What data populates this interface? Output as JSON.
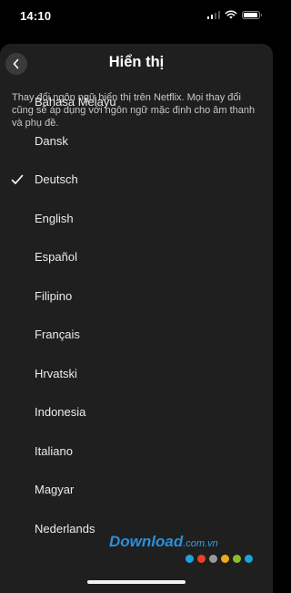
{
  "status_bar": {
    "time": "14:10"
  },
  "header": {
    "title": "Hiển thị",
    "back_icon": "chevron-left-icon"
  },
  "description": "Thay đổi ngôn ngữ hiển thị trên Netflix. Mọi thay đổi cũng sẽ áp dụng với ngôn ngữ mặc định cho âm thanh và phụ đề.",
  "languages": [
    {
      "label": "Bahasa Melayu",
      "selected": false
    },
    {
      "label": "Dansk",
      "selected": false
    },
    {
      "label": "Deutsch",
      "selected": true
    },
    {
      "label": "English",
      "selected": false
    },
    {
      "label": "Español",
      "selected": false
    },
    {
      "label": "Filipino",
      "selected": false
    },
    {
      "label": "Français",
      "selected": false
    },
    {
      "label": "Hrvatski",
      "selected": false
    },
    {
      "label": "Indonesia",
      "selected": false
    },
    {
      "label": "Italiano",
      "selected": false
    },
    {
      "label": "Magyar",
      "selected": false
    },
    {
      "label": "Nederlands",
      "selected": false
    }
  ],
  "watermark": {
    "main": "Download",
    "suffix": ".com.vn",
    "dot_colors": [
      "#1aa3dc",
      "#e8412c",
      "#9a9a9a",
      "#f0a818",
      "#8cbf26",
      "#1aa3dc"
    ]
  },
  "colors": {
    "background": "#000000",
    "sheet": "#1f1f1f",
    "text": "#ffffff",
    "secondary_text": "#c8c8c8"
  }
}
